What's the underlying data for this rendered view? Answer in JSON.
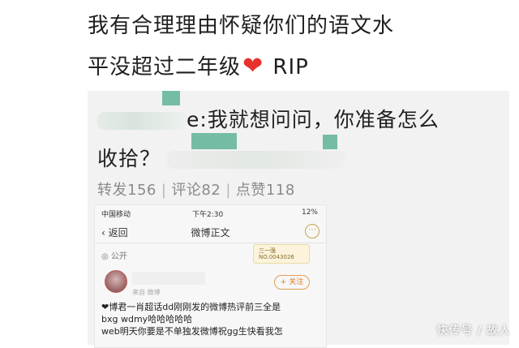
{
  "post": {
    "line1": "我有合理理由怀疑你们的语文水",
    "line2": "平没超过二年级",
    "heart": "❤",
    "rip": "RIP"
  },
  "repost": {
    "line1_tail": "e:我就想问问，你准备怎么",
    "line2": "收拾？",
    "stats": {
      "reposts": "转发156",
      "comments": "评论82",
      "likes": "点赞118",
      "separator": "|"
    }
  },
  "phone": {
    "carrier": "中国移动",
    "time": "下午2:30",
    "battery": "12%",
    "back": "返回",
    "title": "微博正文",
    "public": "公开",
    "badge_line1": "三一强",
    "badge_line2": "NO.0043026",
    "meta": "来自 微博",
    "follow": "+ 关注",
    "body_line1": "❤博君一肖超话dd刚刚发的微博热评前三全是",
    "body_line2": "bxg wdmy哈哈哈哈哈",
    "body_line3": "web明天你要是不单独发微博祝gg生快看我怎"
  },
  "watermark": "快传号 / 故人"
}
